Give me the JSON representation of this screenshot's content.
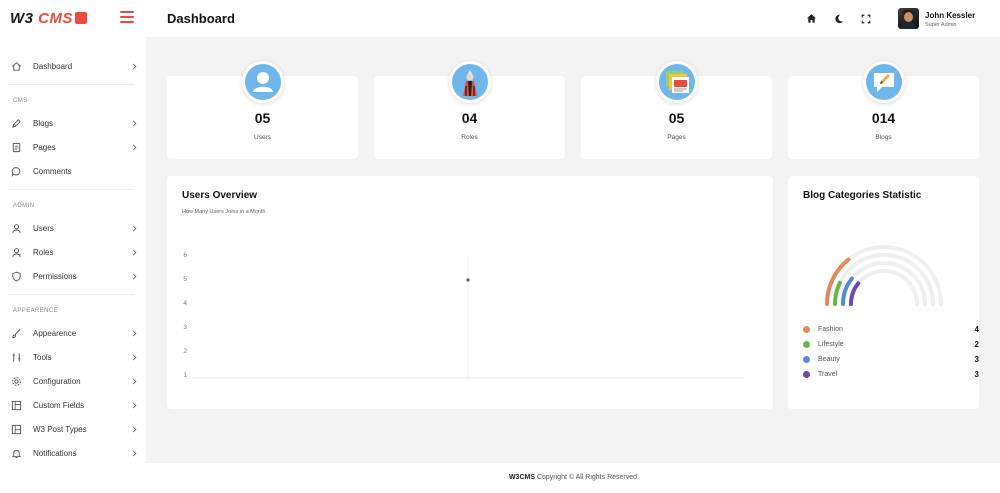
{
  "brand": {
    "logo_text_dark": "W3 ",
    "logo_text_red": "CMS"
  },
  "header": {
    "title": "Dashboard",
    "icons": [
      "home-icon",
      "moon-icon",
      "fullscreen-icon"
    ],
    "user": {
      "name": "John Kessler",
      "role": "Super Admin"
    }
  },
  "sidebar": {
    "dashboard": {
      "label": "Dashboard",
      "icon": "home-icon"
    },
    "sections": [
      {
        "title": "CMS",
        "items": [
          {
            "label": "Blogs",
            "icon": "pencil-icon",
            "has_children": true
          },
          {
            "label": "Pages",
            "icon": "document-icon",
            "has_children": true
          },
          {
            "label": "Comments",
            "icon": "chat-icon",
            "has_children": false
          }
        ]
      },
      {
        "title": "ADMIN",
        "items": [
          {
            "label": "Users",
            "icon": "user-icon",
            "has_children": true
          },
          {
            "label": "Roles",
            "icon": "role-icon",
            "has_children": true
          },
          {
            "label": "Permissions",
            "icon": "shield-icon",
            "has_children": true
          }
        ]
      },
      {
        "title": "APPEARENCE",
        "items": [
          {
            "label": "Appearence",
            "icon": "brush-icon",
            "has_children": true
          },
          {
            "label": "Tools",
            "icon": "tools-icon",
            "has_children": true
          },
          {
            "label": "Configuration",
            "icon": "gear-icon",
            "has_children": true
          },
          {
            "label": "Custom Fields",
            "icon": "fields-icon",
            "has_children": true
          },
          {
            "label": "W3 Post Types",
            "icon": "post-types-icon",
            "has_children": true
          },
          {
            "label": "Notifications",
            "icon": "bell-icon",
            "has_children": true
          }
        ]
      }
    ]
  },
  "stats": [
    {
      "value": "05",
      "label": "Users",
      "icon": "users-icon"
    },
    {
      "value": "04",
      "label": "Roles",
      "icon": "roles-icon"
    },
    {
      "value": "05",
      "label": "Pages",
      "icon": "pages-icon"
    },
    {
      "value": "014",
      "label": "Blogs",
      "icon": "blogs-icon"
    }
  ],
  "users_overview": {
    "title": "Users Overview",
    "subtitle": "How Many Users Joins in a Month"
  },
  "blog_categories": {
    "title": "Blog Categories Statistic"
  },
  "footer": {
    "brand": "W3CMS",
    "text": " Copyright © All Rights Reserved"
  },
  "colors": {
    "accent": "#e94b3c",
    "stat_icon_bg": "#6fb6ea",
    "line_point": "#5a4fb5"
  },
  "chart_data": [
    {
      "type": "line",
      "title": "Users Overview",
      "subtitle": "How Many Users Joins in a Month",
      "x": [
        ""
      ],
      "series": [
        {
          "values": [
            5
          ]
        }
      ],
      "ylim": [
        1,
        6
      ],
      "yticks": [
        "1",
        "2",
        "3",
        "4",
        "5",
        "6"
      ],
      "grid": false
    },
    {
      "type": "radialBar",
      "title": "Blog Categories Statistic",
      "categories": [
        "Fashion",
        "Lifestyle",
        "Beauty",
        "Travel"
      ],
      "values": [
        4,
        2,
        3,
        3
      ],
      "colors": [
        "#e8865a",
        "#66b84a",
        "#4e8fd0",
        "#6b47b8"
      ],
      "max": 14,
      "legend": "bottom"
    }
  ]
}
